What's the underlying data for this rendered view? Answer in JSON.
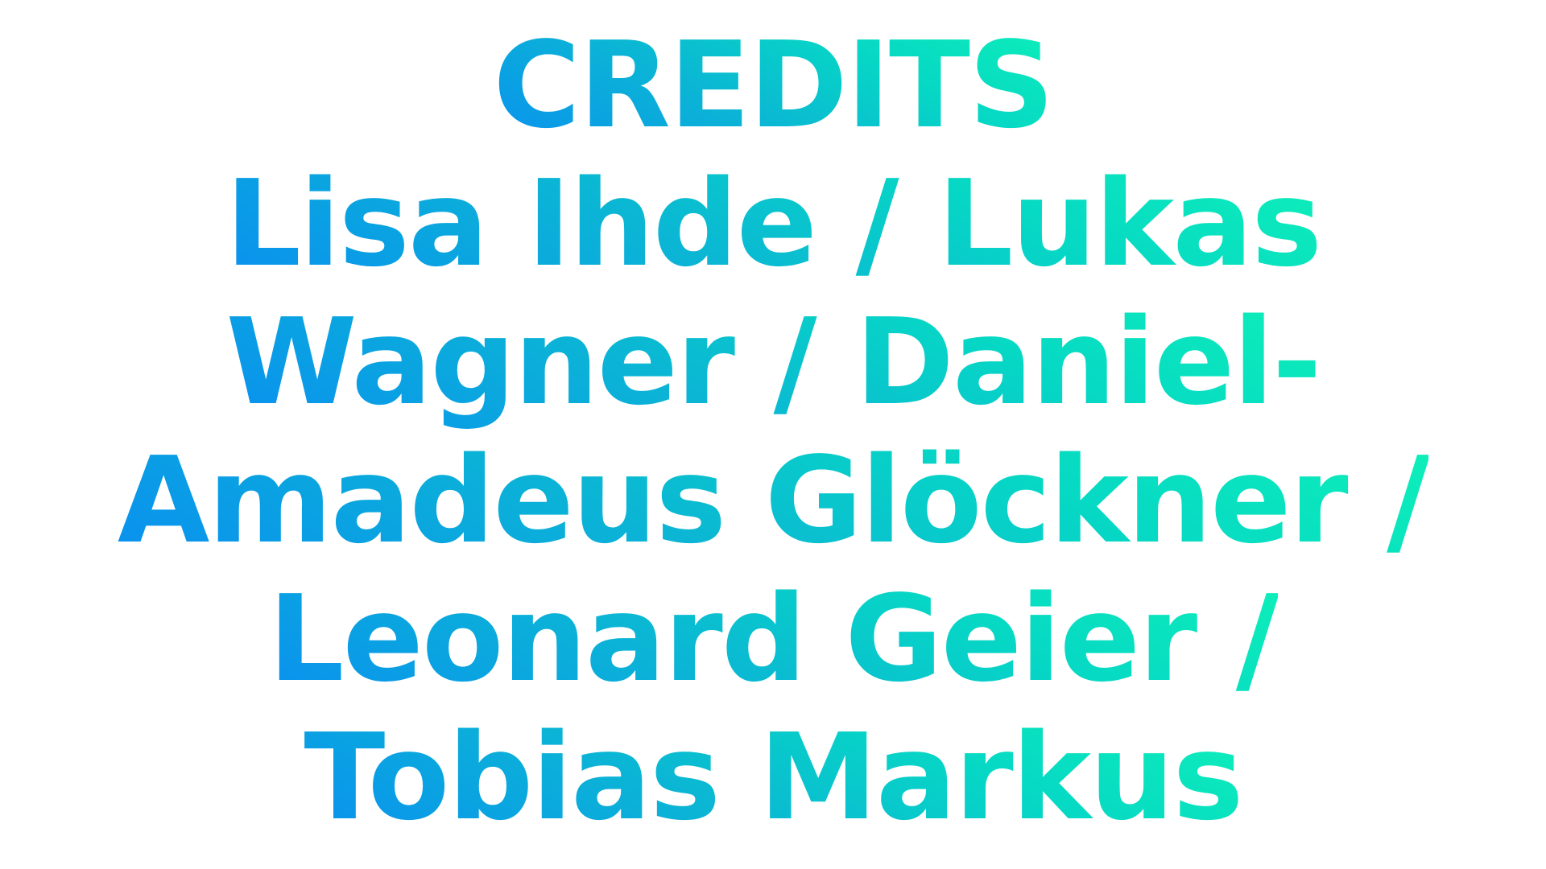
{
  "title": "CREDITS",
  "lines": [
    "Lisa Ihde / Lukas",
    "Wagner / Daniel-",
    "Amadeus Glöckner /",
    "Leonard Geier /",
    "Tobias Markus"
  ],
  "gradient": {
    "start": "#0a8ff0",
    "mid": "#0bb6d4",
    "end": "#0ef0b8"
  }
}
